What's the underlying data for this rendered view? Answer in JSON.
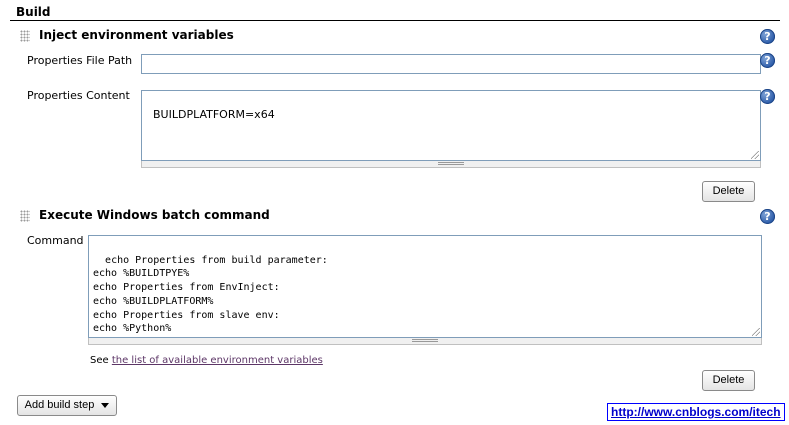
{
  "section": {
    "title": "Build"
  },
  "steps": [
    {
      "title": "Inject environment variables",
      "fields": {
        "properties_file_path": {
          "label": "Properties File Path",
          "value": ""
        },
        "properties_content": {
          "label": "Properties Content",
          "value": "BUILDPLATFORM=x64"
        }
      },
      "delete_label": "Delete"
    },
    {
      "title": "Execute Windows batch command",
      "fields": {
        "command": {
          "label": "Command",
          "value": "echo Properties from build parameter:\necho %BUILDTPYE%\necho Properties from EnvInject:\necho %BUILDPLATFORM%\necho Properties from slave env:\necho %Python%\necho %BuildToolsRoot%"
        }
      },
      "see_text": "See",
      "env_link_text": "the list of available environment variables",
      "delete_label": "Delete"
    }
  ],
  "help_glyph": "?",
  "add_build_step": {
    "label": "Add build step",
    "icon": "caret-down-icon"
  },
  "watermark": "http://www.cnblogs.com/itech",
  "colors": {
    "field_border": "#7f9db9",
    "help_icon": "#2a5aa8",
    "link": "#5c3566",
    "watermark": "#0000cc"
  }
}
